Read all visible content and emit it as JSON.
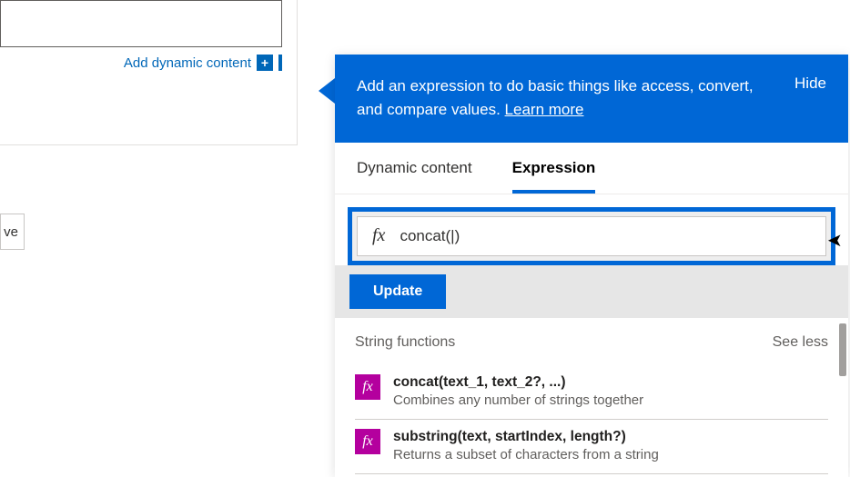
{
  "left": {
    "add_dynamic_content": "Add dynamic content",
    "save_fragment": "ve"
  },
  "popover": {
    "banner_text": "Add an expression to do basic things like access, convert, and compare values. ",
    "learn_more": "Learn more",
    "hide": "Hide",
    "tabs": {
      "dynamic": "Dynamic content",
      "expression": "Expression"
    },
    "fx_label": "fx",
    "expression_value": "concat(|)",
    "update": "Update",
    "section_title": "String functions",
    "see_toggle": "See less",
    "functions": [
      {
        "signature": "concat(text_1, text_2?, ...)",
        "description": "Combines any number of strings together"
      },
      {
        "signature": "substring(text, startIndex, length?)",
        "description": "Returns a subset of characters from a string"
      }
    ]
  }
}
